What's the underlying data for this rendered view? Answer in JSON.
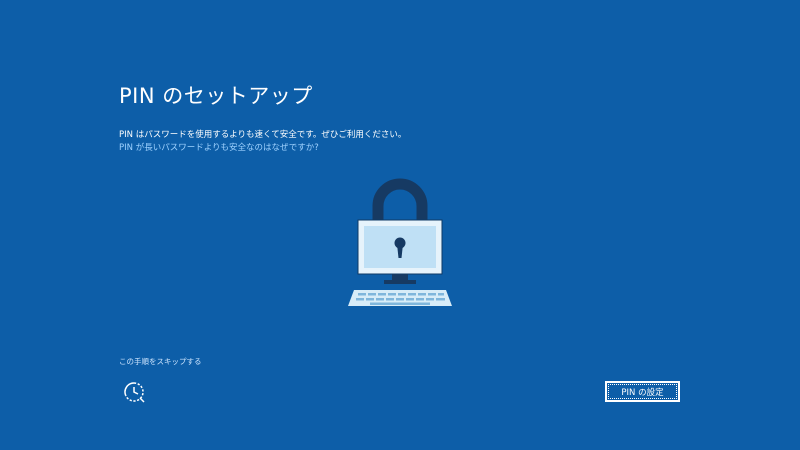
{
  "page": {
    "title": "PIN のセットアップ",
    "description": "PIN はパスワードを使用するよりも速くて安全です。ぜひご利用ください。",
    "why_link": "PIN が長いパスワードよりも安全なのはなぜですか?",
    "skip_link": "この手順をスキップする",
    "pin_button_label": "PIN の設定"
  },
  "icons": {
    "illustration": "lock-computer-icon",
    "accessibility": "ease-of-access-icon"
  },
  "colors": {
    "background": "#0d5ea8",
    "link": "#9fd2ff",
    "lock_shackle": "#163a63",
    "lock_body": "#cfe7f7",
    "lock_screen": "#bfe0f5",
    "keyboard": "#d7ecf8"
  }
}
